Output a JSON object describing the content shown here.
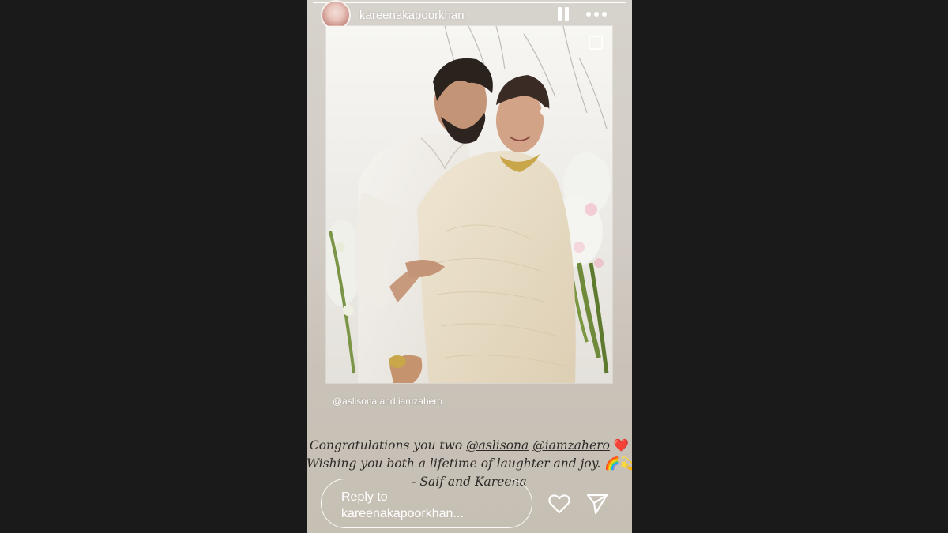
{
  "story": {
    "username": "kareenakapoorkhan",
    "progress": 1.0,
    "mention_tag": {
      "handle1": "@aslisona",
      "joiner": "and",
      "handle2": "iamzahero"
    },
    "caption": {
      "line1_prefix": "Congratulations you two",
      "line1_mention1": "@aslisona",
      "line1_mention2": "@iamzahero",
      "line1_emoji": "❤️",
      "line2_text": "Wishing you both a lifetime of laughter and joy.",
      "line2_emoji": "🌈💫",
      "line3": "- Saif and Kareena"
    },
    "reply": {
      "placeholder_line1": "Reply to",
      "placeholder_line2": "kareenakapoorkhan..."
    }
  },
  "icons": {
    "pause": "pause-icon",
    "more": "more-options-icon",
    "like": "heart-icon",
    "send": "send-icon",
    "multi_photo": "copy-icon"
  }
}
